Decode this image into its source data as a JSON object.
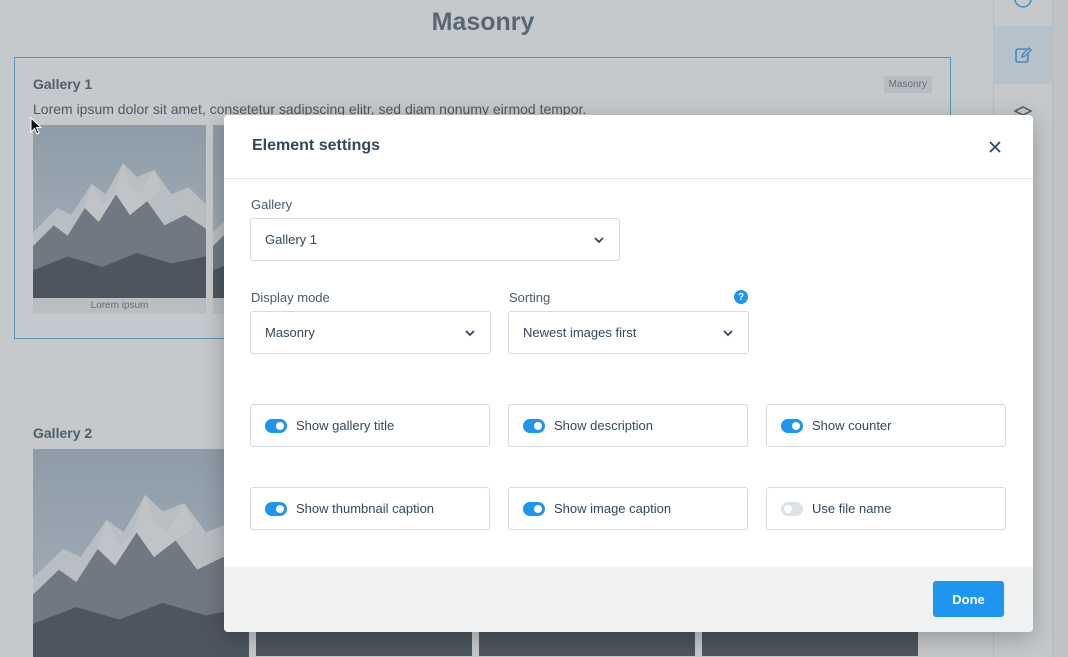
{
  "page": {
    "title": "Masonry",
    "gallery1": {
      "title": "Gallery 1",
      "badge": "Masonry",
      "description": "Lorem ipsum dolor sit amet, consetetur sadipscing elitr, sed diam nonumy eirmod tempor.",
      "thumb_caption": "Lorem ipsum"
    },
    "gallery2": {
      "title": "Gallery 2"
    }
  },
  "rail": {
    "items": [
      {
        "icon": "help-circle-icon"
      },
      {
        "icon": "edit-icon",
        "active": true
      },
      {
        "icon": "layers-icon"
      }
    ]
  },
  "modal": {
    "title": "Element settings",
    "close_icon": "close-icon",
    "gallery": {
      "label": "Gallery",
      "value": "Gallery 1"
    },
    "display_mode": {
      "label": "Display mode",
      "value": "Masonry"
    },
    "sorting": {
      "label": "Sorting",
      "value": "Newest images first",
      "help": "?"
    },
    "toggles": [
      {
        "label": "Show gallery title",
        "on": true
      },
      {
        "label": "Show description",
        "on": true
      },
      {
        "label": "Show counter",
        "on": true
      },
      {
        "label": "Show thumbnail caption",
        "on": true
      },
      {
        "label": "Show image caption",
        "on": true
      },
      {
        "label": "Use file name",
        "on": false
      }
    ],
    "done_label": "Done"
  },
  "colors": {
    "accent": "#1e96f0",
    "heading": "#33475b",
    "border": "#d5dbe0",
    "footer_bg": "#eff1f3"
  }
}
